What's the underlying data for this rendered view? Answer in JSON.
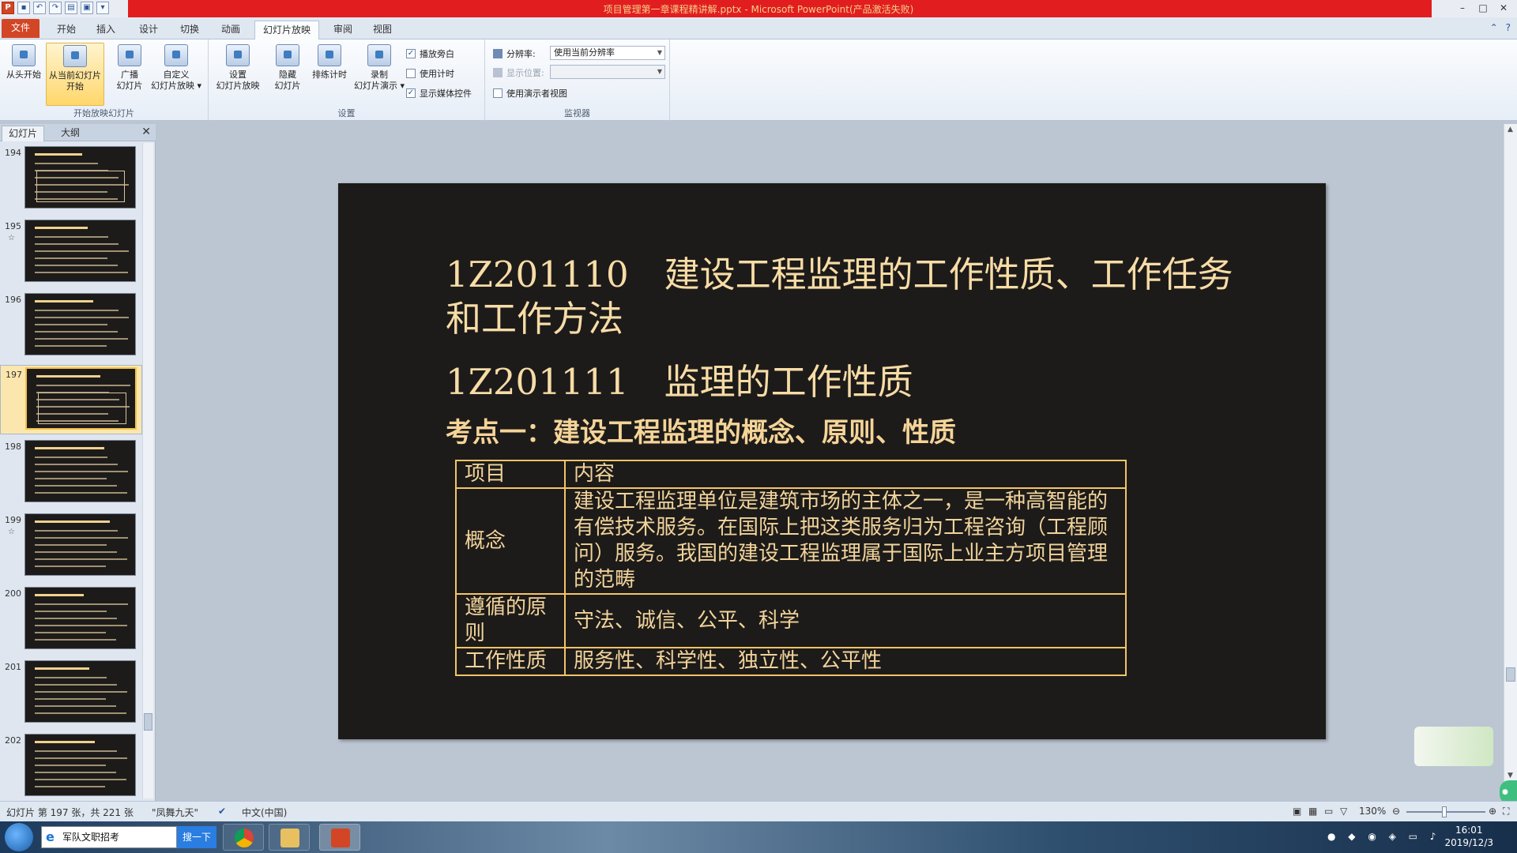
{
  "window": {
    "title": "项目管理第一章课程精讲解.pptx - Microsoft PowerPoint(产品激活失败)",
    "controls": [
      "–",
      "□",
      "✕"
    ]
  },
  "ribbon_tabs": [
    "文件",
    "开始",
    "插入",
    "设计",
    "切换",
    "动画",
    "幻灯片放映",
    "审阅",
    "视图"
  ],
  "ribbon": {
    "group_start": {
      "label": "开始放映幻灯片",
      "from_start": "从头开始",
      "from_current_1": "从当前幻灯片",
      "from_current_2": "开始",
      "broadcast_1": "广播",
      "broadcast_2": "幻灯片",
      "custom_1": "自定义",
      "custom_2": "幻灯片放映 ▾"
    },
    "group_setup": {
      "label": "设置",
      "setup_1": "设置",
      "setup_2": "幻灯片放映",
      "hide_1": "隐藏",
      "hide_2": "幻灯片",
      "rehearse": "排练计时",
      "record_1": "录制",
      "record_2": "幻灯片演示 ▾",
      "play_narration": "播放旁白",
      "use_timings": "使用计时",
      "show_media": "显示媒体控件"
    },
    "group_monitors": {
      "label": "监视器",
      "resolution_label": "分辨率:",
      "resolution_value": "使用当前分辨率",
      "show_on_label": "显示位置:",
      "show_on_value": "",
      "presenter_view": "使用演示者视图"
    }
  },
  "panel": {
    "tab_slides": "幻灯片",
    "tab_outline": "大纲",
    "close": "✕",
    "thumbnails": [
      {
        "num": "194",
        "star": ""
      },
      {
        "num": "195",
        "star": "☆"
      },
      {
        "num": "196",
        "star": ""
      },
      {
        "num": "197",
        "star": ""
      },
      {
        "num": "198",
        "star": ""
      },
      {
        "num": "199",
        "star": "☆"
      },
      {
        "num": "200",
        "star": ""
      },
      {
        "num": "201",
        "star": ""
      },
      {
        "num": "202",
        "star": ""
      }
    ],
    "selected_index": 3
  },
  "slide": {
    "title": "1Z201110　建设工程监理的工作性质、工作任务和工作方法",
    "subtitle": "1Z201111　监理的工作性质",
    "point": "考点一：建设工程监理的概念、原则、性质",
    "table": {
      "header": [
        "项目",
        "内容"
      ],
      "rows": [
        [
          "概念",
          "建设工程监理单位是建筑市场的主体之一，是一种高智能的有偿技术服务。在国际上把这类服务归为工程咨询（工程顾问）服务。我国的建设工程监理属于国际上业主方项目管理的范畴"
        ],
        [
          "遵循的原则",
          "守法、诚信、公平、科学"
        ],
        [
          "工作性质",
          "服务性、科学性、独立性、公平性"
        ]
      ]
    }
  },
  "statusbar": {
    "slide_info": "幻灯片 第 197 张，共 221 张",
    "theme": "\"凤舞九天\"",
    "language": "中文(中国)",
    "zoom": "130%"
  },
  "taskbar": {
    "search_text": "军队文职招考",
    "search_button": "搜一下",
    "time": "16:01",
    "date": "2019/12/3"
  },
  "colors": {
    "slide_bg": "#1d1b1a",
    "slide_text": "#f7dca6",
    "table_border": "#f3c468",
    "title_bar_red": "#e21d20",
    "file_tab": "#d24625"
  }
}
